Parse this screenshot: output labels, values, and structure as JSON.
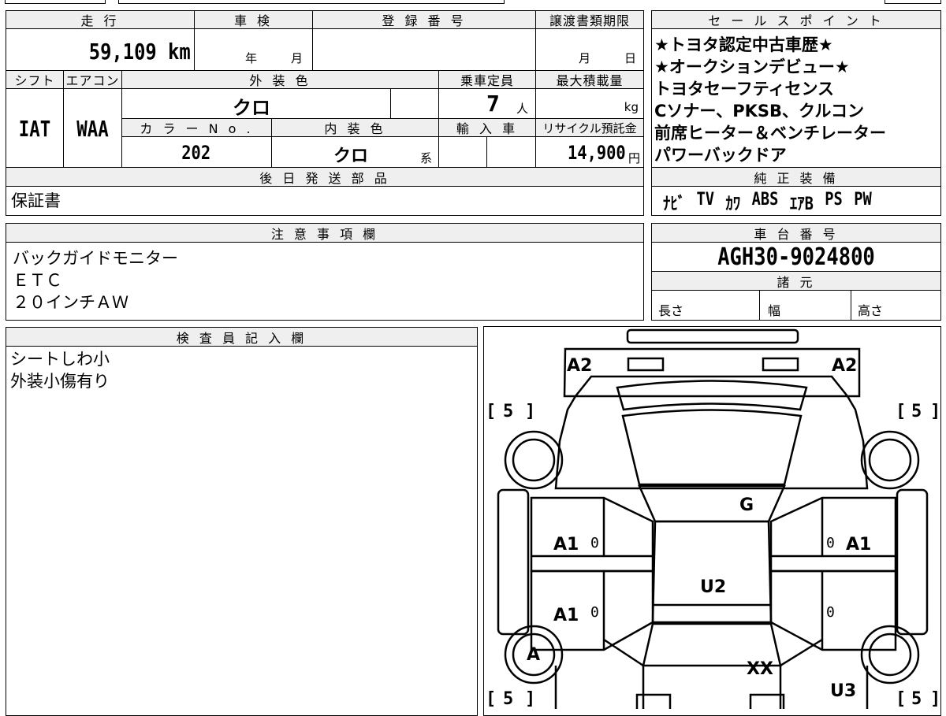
{
  "mileage": {
    "header": "走 行",
    "value": "59,109 km"
  },
  "inspection": {
    "header": "車 検",
    "year_unit": "年",
    "month_unit": "月"
  },
  "registration": {
    "header": "登 録 番 号"
  },
  "transfer_deadline": {
    "header": "譲渡書類期限",
    "month_unit": "月",
    "day_unit": "日"
  },
  "shift": {
    "header": "シフト",
    "value": "IAT"
  },
  "aircon": {
    "header": "エアコン",
    "value": "WAA"
  },
  "exterior_color": {
    "header": "外 装 色",
    "value": "クロ"
  },
  "capacity": {
    "header": "乗車定員",
    "value": "7",
    "unit": "人"
  },
  "max_load": {
    "header": "最大積載量",
    "unit": "kg"
  },
  "color_no": {
    "header": "カ ラ ー N o .",
    "value": "202"
  },
  "interior_color": {
    "header": "内 装 色",
    "value": "クロ",
    "suffix": "系"
  },
  "import": {
    "header": "輸 入 車"
  },
  "recycle_fee": {
    "header": "リサイクル預託金",
    "value": "14,900",
    "unit": "円"
  },
  "later_parts": {
    "header": "後 日 発 送 部 品",
    "value": "保証書"
  },
  "sales_points": {
    "header": "セ ー ル ス ポ イ ン ト",
    "items": [
      "★トヨタ認定中古車歴★",
      "★オークションデビュー★",
      "トヨタセーフティセンス",
      "Cソナー、PKSB、クルコン",
      "前席ヒーター＆ベンチレーター",
      "パワーバックドア"
    ]
  },
  "equipment": {
    "header": "純 正 装 備",
    "items": [
      "ﾅﾋﾞ",
      "TV",
      "ｶﾜ",
      "ABS",
      "ｴｱB",
      "PS",
      "PW"
    ]
  },
  "notes": {
    "header": "注 意 事 項 欄",
    "items": [
      "バックガイドモニター",
      "ＥＴＣ",
      "２０インチＡＷ"
    ]
  },
  "chassis": {
    "header": "車 台 番 号",
    "value": "AGH30-9024800"
  },
  "specs": {
    "header": "諸 元",
    "length": "長さ",
    "width": "幅",
    "height": "高さ"
  },
  "inspector": {
    "header": "検 査 員 記 入 欄",
    "items": [
      "シートしわ小",
      "外装小傷有り"
    ]
  },
  "diagram": {
    "a2_left": "A2",
    "a2_right": "A2",
    "tire_fl": "5",
    "tire_fr": "5",
    "tire_rl": "5",
    "tire_rr": "5",
    "g": "G",
    "a1_left_front": "A1",
    "a1_left_rear": "A1",
    "a1_right_front": "A1",
    "u2": "U2",
    "a_left_rear": "A",
    "xx": "XX",
    "u3": "U3",
    "zero_lf": "0",
    "zero_lr": "0",
    "zero_rf": "0",
    "zero_rr": "0",
    "bracket_open": "[",
    "bracket_close": "]"
  }
}
